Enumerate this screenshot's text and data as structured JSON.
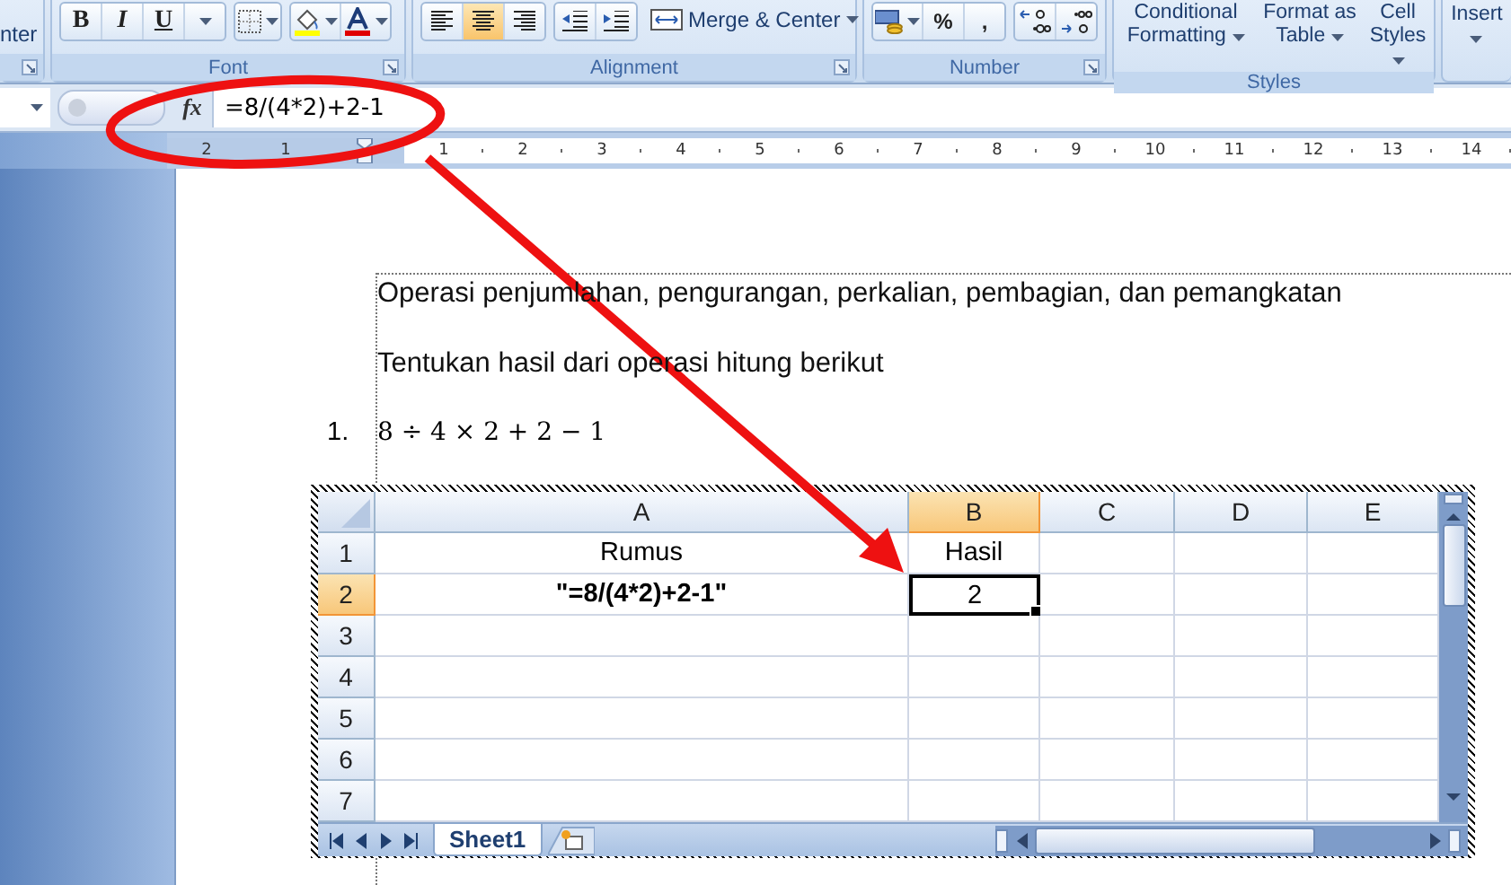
{
  "ribbon": {
    "cut_button": "nter",
    "font": {
      "label": "Font",
      "style_buttons": [
        "B",
        "I",
        "U"
      ]
    },
    "alignment": {
      "label": "Alignment",
      "align_buttons": [
        {
          "kind": "left",
          "selected": false
        },
        {
          "kind": "center",
          "selected": true
        },
        {
          "kind": "right",
          "selected": false
        }
      ],
      "merge_button": "Merge & Center"
    },
    "number": {
      "label": "Number",
      "buttons": [
        "%",
        ","
      ]
    },
    "styles": {
      "label": "Styles",
      "buttons": [
        "Conditional Formatting",
        "Format as Table",
        "Cell Styles"
      ]
    },
    "cut_group_button": "Insert"
  },
  "formula_bar": {
    "function_label": "fx",
    "formula": "=8/(4*2)+2-1"
  },
  "ruler": {
    "left_labels": [
      "2",
      "1"
    ],
    "labels": [
      "1",
      "2",
      "3",
      "4",
      "5",
      "6",
      "7",
      "8",
      "9",
      "10",
      "11",
      "12",
      "13",
      "14"
    ]
  },
  "document": {
    "paragraphs": [
      "Operasi penjumlahan, pengurangan, perkalian, pembagian, dan pemangkatan",
      "Tentukan hasil dari operasi hitung berikut"
    ],
    "list": [
      {
        "number": "1.",
        "text": "8 ÷ 4 × 2 + 2 − 1"
      }
    ]
  },
  "sheet": {
    "columns": [
      {
        "label": "A",
        "selected": false
      },
      {
        "label": "B",
        "selected": true
      },
      {
        "label": "C",
        "selected": false
      },
      {
        "label": "D",
        "selected": false
      },
      {
        "label": "E",
        "selected": false
      }
    ],
    "rows": [
      {
        "number": "1",
        "selected": false,
        "cells": [
          {
            "text": "Rumus",
            "bold": false,
            "selected": false
          },
          {
            "text": "Hasil",
            "bold": false,
            "selected": false
          }
        ]
      },
      {
        "number": "2",
        "selected": true,
        "cells": [
          {
            "text": "\"=8/(4*2)+2-1\"",
            "bold": true,
            "selected": false
          },
          {
            "text": "2",
            "bold": false,
            "selected": true
          }
        ]
      },
      {
        "number": "3",
        "selected": false,
        "cells": []
      },
      {
        "number": "4",
        "selected": false,
        "cells": []
      },
      {
        "number": "5",
        "selected": false,
        "cells": []
      },
      {
        "number": "6",
        "selected": false,
        "cells": []
      },
      {
        "number": "7",
        "selected": false,
        "cells": []
      }
    ],
    "tabs": [
      {
        "label": "Sheet1",
        "selected": true
      }
    ]
  }
}
